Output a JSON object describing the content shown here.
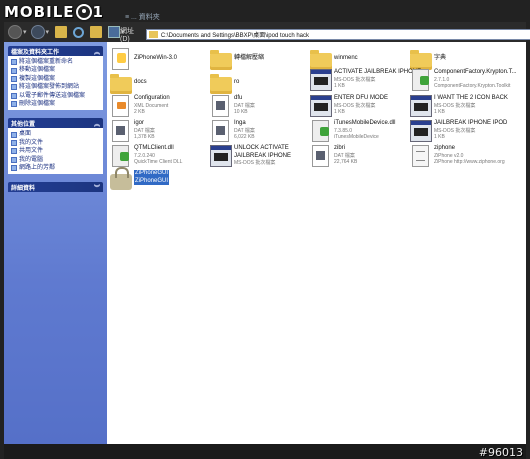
{
  "logo": {
    "text_left": "MOBILE",
    "text_right": "1"
  },
  "window": {
    "title": "≡ ... 資料夾"
  },
  "address": {
    "label": "網址(D)",
    "path": "C:\\Documents and Settings\\BBXP\\桌面\\ipod touch hack"
  },
  "left_panel": {
    "file_tasks": {
      "title": "檔案及資料夾工作",
      "items": [
        "將這個檔案重新命名",
        "移動這個檔案",
        "複製這個檔案",
        "將這個檔案發佈到網站",
        "以電子郵件傳送這個檔案",
        "刪除這個檔案"
      ]
    },
    "other_places": {
      "title": "其他位置",
      "items": [
        "桌面",
        "我的文件",
        "共用文件",
        "我的電腦",
        "網路上的芳鄰"
      ]
    },
    "details": {
      "title": "詳細資料"
    }
  },
  "files": [
    {
      "name": "ZiPhoneWin-3.0",
      "sub1": "",
      "sub2": "",
      "icon": "zip-icon"
    },
    {
      "name": "轉檔解壓縮",
      "sub1": "",
      "sub2": "",
      "icon": "folder-icon"
    },
    {
      "name": "winmenc",
      "sub1": "",
      "sub2": "",
      "icon": "folder-icon"
    },
    {
      "name": "字典",
      "sub1": "",
      "sub2": "",
      "icon": "folder-icon"
    },
    {
      "name": "docs",
      "sub1": "",
      "sub2": "",
      "icon": "folder-icon"
    },
    {
      "name": "ro",
      "sub1": "",
      "sub2": "",
      "icon": "folder-icon"
    },
    {
      "name": "ACTIVATE JAILBREAK IPHONE",
      "sub1": "MS-DOS 批次檔案",
      "sub2": "1 KB",
      "icon": "batch-icon"
    },
    {
      "name": "ComponentFactory.Krypton.T...",
      "sub1": "2.7.1.0",
      "sub2": "ComponentFactory.Krypton.Toolkit",
      "icon": "dll-icon"
    },
    {
      "name": "Configuration",
      "sub1": "XML Document",
      "sub2": "2 KB",
      "icon": "xml-icon"
    },
    {
      "name": "dfu",
      "sub1": "DAT 檔案",
      "sub2": "10 KB",
      "icon": "dat-icon"
    },
    {
      "name": "ENTER DFU MODE",
      "sub1": "MS-DOS 批次檔案",
      "sub2": "1 KB",
      "icon": "batch-icon"
    },
    {
      "name": "I WANT THE 2 ICON BACK",
      "sub1": "MS-DOS 批次檔案",
      "sub2": "1 KB",
      "icon": "batch-icon"
    },
    {
      "name": "igor",
      "sub1": "DAT 檔案",
      "sub2": "1,378 KB",
      "icon": "dat-icon"
    },
    {
      "name": "Inga",
      "sub1": "DAT 檔案",
      "sub2": "6,022 KB",
      "icon": "dat-icon"
    },
    {
      "name": "iTunesMobileDevice.dll",
      "sub1": "7.3.85.0",
      "sub2": "iTunesMobileDevice",
      "icon": "dll-icon"
    },
    {
      "name": "JAILBREAK IPHONE IPOD",
      "sub1": "MS-DOS 批次檔案",
      "sub2": "1 KB",
      "icon": "batch-icon"
    },
    {
      "name": "QTMLClient.dll",
      "sub1": "7.2.0.240",
      "sub2": "QuickTime Client DLL",
      "icon": "dll-icon"
    },
    {
      "name": "UNLOCK ACTIVATE JAILBREAK IPHONE",
      "sub1": "MS-DOS 批次檔案",
      "sub2": "",
      "icon": "batch-icon"
    },
    {
      "name": "zibri",
      "sub1": "DAT 檔案",
      "sub2": "22,764 KB",
      "icon": "dat-icon"
    },
    {
      "name": "ziphone",
      "sub1": "ZiPhone v2.0",
      "sub2": "ZiPhone http://www.ziphone.org",
      "icon": "app-icon"
    },
    {
      "name": "ZiPhoneGUI",
      "sub1": "ZiPhoneGUI",
      "sub2": "",
      "icon": "lock-icon"
    }
  ],
  "watermark": {
    "id": "#96013"
  }
}
